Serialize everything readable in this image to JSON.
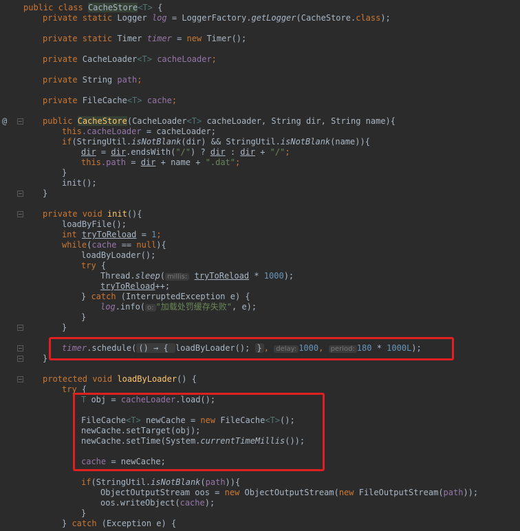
{
  "editor": {
    "gutter_icons": [
      "override-at-icon"
    ],
    "highlight_color": "#e02020"
  },
  "code": {
    "l01_kw": "public class",
    "l01_cls": "CacheStore",
    "l01_tp": "<T>",
    "l01_rest": " {",
    "l02_kw": "private static",
    "l02_a": " Logger ",
    "l02_f": "log",
    "l02_b": " = LoggerFactory.",
    "l02_m": "getLogger",
    "l02_c": "(CacheStore.",
    "l02_kw2": "class",
    "l02_d": ");",
    "l03_kw": "private static",
    "l03_a": " Timer ",
    "l03_f": "timer",
    "l03_b": " = ",
    "l03_kw2": "new",
    "l03_c": " Timer();",
    "l04_kw": "private",
    "l04_a": " CacheLoader",
    "l04_tp": "<T>",
    "l04_f": " cacheLoader",
    "l04_b": ";",
    "l05_kw": "private",
    "l05_a": " String ",
    "l05_f": "path",
    "l05_b": ";",
    "l06_kw": "private",
    "l06_a": " FileCache",
    "l06_tp": "<T>",
    "l06_f": " cache",
    "l06_b": ";",
    "l07_kw": "public",
    "l07_cls": "CacheStore",
    "l07_a": "(CacheLoader",
    "l07_tp": "<T>",
    "l07_b": " cacheLoader, String dir, String name){",
    "l08_kw": "this",
    "l08_f": ".cacheLoader",
    "l08_a": " = cacheLoader;",
    "l09_kw": "if",
    "l09_a": "(StringUtil.",
    "l09_m": "isNotBlank",
    "l09_b": "(dir) && StringUtil.",
    "l09_m2": "isNotBlank",
    "l09_c": "(name)){",
    "l10_u": "dir",
    "l10_a": " = ",
    "l10_u2": "dir",
    "l10_b": ".endsWith(",
    "l10_s": "\"/\"",
    "l10_c": ") ? ",
    "l10_u3": "dir",
    "l10_d": " : ",
    "l10_u4": "dir",
    "l10_e": " + ",
    "l10_s2": "\"/\"",
    "l10_f": ";",
    "l11_kw": "this",
    "l11_f": ".path",
    "l11_a": " = ",
    "l11_u": "dir",
    "l11_b": " + name + ",
    "l11_s": "\".dat\"",
    "l11_c": ";",
    "l12": "}",
    "l13": "init();",
    "l14": "}",
    "l15_kw": "private void",
    "l15_a": " init",
    "l15_b": "(){",
    "l16": "loadByFile();",
    "l17_kw": "int",
    "l17_u": "tryToReload",
    "l17_a": " = ",
    "l17_n": "1",
    "l17_b": ";",
    "l18_kw": "while",
    "l18_a": "(",
    "l18_f": "cache",
    "l18_b": " == ",
    "l18_kw2": "null",
    "l18_c": "){",
    "l19": "loadByLoader();",
    "l20_kw": "try",
    "l20_a": " {",
    "l21_a": "Thread.",
    "l21_m": "sleep",
    "l21_b": "(",
    "l21_h": "millis:",
    "l21_u": "tryToReload",
    "l21_c": " * ",
    "l21_n": "1000",
    "l21_d": ");",
    "l22_u": "tryToReload",
    "l22_a": "++;",
    "l23_a": "} ",
    "l23_kw": "catch",
    "l23_b": " (InterruptedException e) {",
    "l24_f": "log",
    "l24_a": ".info(",
    "l24_h": "o:",
    "l24_s": "\"加载处罚缓存失败\"",
    "l24_b": ", e);",
    "l25": "}",
    "l26": "}",
    "l27_f": "timer",
    "l27_a": ".schedule(",
    "l27_b": "() → { ",
    "l27_c": "loadByLoader(); ",
    "l27_d": "}",
    "l27_e": ", ",
    "l27_h": "delay:",
    "l27_n": "1000",
    "l27_f2": ", ",
    "l27_h2": "period:",
    "l27_n2": "180",
    "l27_g": " * ",
    "l27_n3": "1000L",
    "l27_i": ");",
    "l28": "}",
    "l29_kw": "protected void",
    "l29_a": " loadByLoader",
    "l29_b": "() {",
    "l30_kw": "try",
    "l30_a": " {",
    "l31_tp": "T",
    "l31_a": " obj = ",
    "l31_f": "cacheLoader",
    "l31_b": ".load();",
    "l32_a": "FileCache",
    "l32_tp": "<T>",
    "l32_b": " newCache = ",
    "l32_kw": "new",
    "l32_c": " FileCache",
    "l32_tp2": "<T>",
    "l32_d": "();",
    "l33": "newCache.setTarget(obj);",
    "l34_a": "newCache.setTime(System.",
    "l34_m": "currentTimeMillis",
    "l34_b": "());",
    "l35_f": "cache",
    "l35_a": " = newCache;",
    "l36_kw": "if",
    "l36_a": "(StringUtil.",
    "l36_m": "isNotBlank",
    "l36_b": "(",
    "l36_f": "path",
    "l36_c": ")){",
    "l37_a": "ObjectOutputStream oos = ",
    "l37_kw": "new",
    "l37_b": " ObjectOutputStream(",
    "l37_kw2": "new",
    "l37_c": " FileOutputStream(",
    "l37_f": "path",
    "l37_d": "));",
    "l38_a": "oos.writeObject(",
    "l38_f": "cache",
    "l38_b": ");",
    "l39": "}",
    "l40_a": "} ",
    "l40_kw": "catch",
    "l40_b": " (Exception e) {"
  }
}
